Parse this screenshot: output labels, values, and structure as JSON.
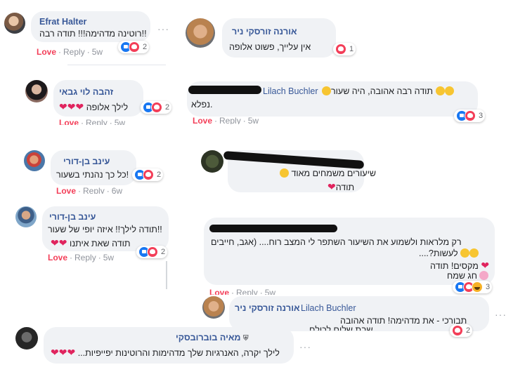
{
  "comments": [
    {
      "id": "c1",
      "name": "Efrat Halter",
      "text": "!!רוטינה מדהימה!!! תודה רבה",
      "love": "Love",
      "reply": "Reply",
      "time": "5w",
      "count": "2"
    },
    {
      "id": "c2",
      "name": "אורנה זורסקי ניר",
      "text": "אין עלייך, פשוט אלופה",
      "count": "1"
    },
    {
      "id": "c3",
      "name": "זהבה לוי גבאי",
      "text": "לילך אלופה",
      "hearts": "❤❤❤",
      "love": "Love",
      "reply": "Reply",
      "time": "5w",
      "count": "2"
    },
    {
      "id": "c4",
      "name_tag": "Lilach Buchler",
      "text": "תודה רבה אהובה, היה שעור",
      "text2": ".נפלא",
      "love": "Love",
      "reply": "Reply",
      "time": "5w",
      "count": "3"
    },
    {
      "id": "c5",
      "name": "עינב בן-דורי",
      "text": "!כל כך נהנתי בשעור",
      "love": "Love",
      "reply": "Reply",
      "time": "6w",
      "count": "2"
    },
    {
      "id": "c6",
      "text": "שיעורים משמחים מאוד",
      "text2": "תודה"
    },
    {
      "id": "c7",
      "name": "עינב בן-דורי",
      "text": "!!תודה לילך!! איזה יופי של שעור",
      "text2": "תודה שאת איתנו",
      "hearts": "❤❤",
      "love": "Love",
      "reply": "Reply",
      "time": "5w",
      "count": "2"
    },
    {
      "id": "c8",
      "text": "רק מלראות ולשמוע את השיעור השתפר לי המצב רוח.... (אגב, חייבים",
      "text2": "לעשות?....",
      "text3": "מקסים! תודה",
      "text4": "חג שמח",
      "love": "Love",
      "reply": "Reply",
      "time": "5w",
      "count": "3"
    },
    {
      "id": "c9",
      "name": "אורנה זורסקי ניר",
      "name_tag": "Lilach Buchler",
      "text": "תבורכי - את מדהימה! תודה אהובה",
      "text2": "שבת שלום לכולם",
      "count": "2"
    },
    {
      "id": "c10",
      "name": "מאיה בוברובסקי",
      "text": "לילך יקרה, האנרגיות שלך מדהימות והרוטינות יפייפיות...",
      "hearts": "❤❤❤"
    }
  ],
  "icons": {
    "more": "more-dots-icon",
    "like": "like-icon",
    "love": "love-icon",
    "haha": "haha-icon",
    "shield": "shield-icon"
  },
  "colors": {
    "name": "#385898",
    "love": "#f33e58",
    "bubble": "#f0f2f5",
    "like": "#1877f2"
  }
}
